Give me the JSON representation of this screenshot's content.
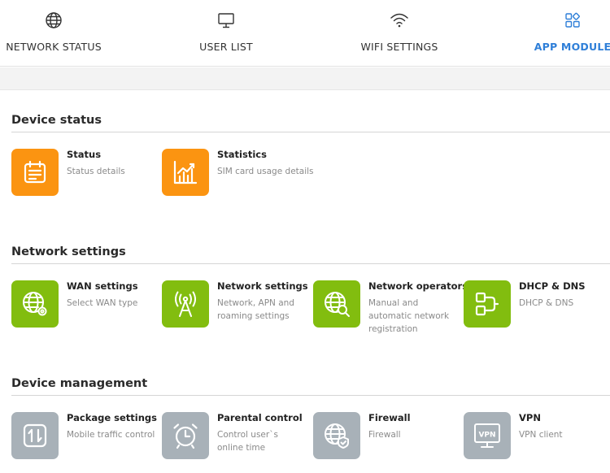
{
  "nav": {
    "items": [
      {
        "label": "NETWORK STATUS",
        "icon": "globe-icon"
      },
      {
        "label": "USER LIST",
        "icon": "monitor-icon"
      },
      {
        "label": "WIFI SETTINGS",
        "icon": "wifi-icon"
      },
      {
        "label": "APP MODULE",
        "icon": "app-grid-icon",
        "active": true
      }
    ],
    "active_color": "#2f7fd8"
  },
  "sections": [
    {
      "title": "Device status",
      "cards": [
        {
          "title": "Status",
          "desc": "Status details",
          "icon": "status-clipboard-icon",
          "color": "#fb9411"
        },
        {
          "title": "Statistics",
          "desc": "SIM card usage details",
          "icon": "statistics-chart-icon",
          "color": "#fb9411"
        }
      ]
    },
    {
      "title": "Network settings",
      "cards": [
        {
          "title": "WAN settings",
          "desc": "Select WAN type",
          "icon": "wan-globe-gear-icon",
          "color": "#82bd0f"
        },
        {
          "title": "Network settings",
          "desc": "Network, APN and roaming settings",
          "icon": "antenna-tower-icon",
          "color": "#82bd0f"
        },
        {
          "title": "Network operators",
          "desc": "Manual and automatic network registration",
          "icon": "globe-search-icon",
          "color": "#82bd0f"
        },
        {
          "title": "DHCP & DNS",
          "desc": "DHCP & DNS",
          "icon": "dhcp-blocks-icon",
          "color": "#82bd0f"
        }
      ]
    },
    {
      "title": "Device management",
      "cards": [
        {
          "title": "Package settings",
          "desc": "Mobile traffic control",
          "icon": "traffic-arrows-icon",
          "color": "#a8b1b8"
        },
        {
          "title": "Parental control",
          "desc": "Control user`s online time",
          "icon": "alarm-clock-icon",
          "color": "#a8b1b8"
        },
        {
          "title": "Firewall",
          "desc": "Firewall",
          "icon": "globe-shield-icon",
          "color": "#a8b1b8"
        },
        {
          "title": "VPN",
          "desc": "VPN client",
          "icon": "vpn-monitor-icon",
          "color": "#a8b1b8"
        }
      ]
    }
  ]
}
